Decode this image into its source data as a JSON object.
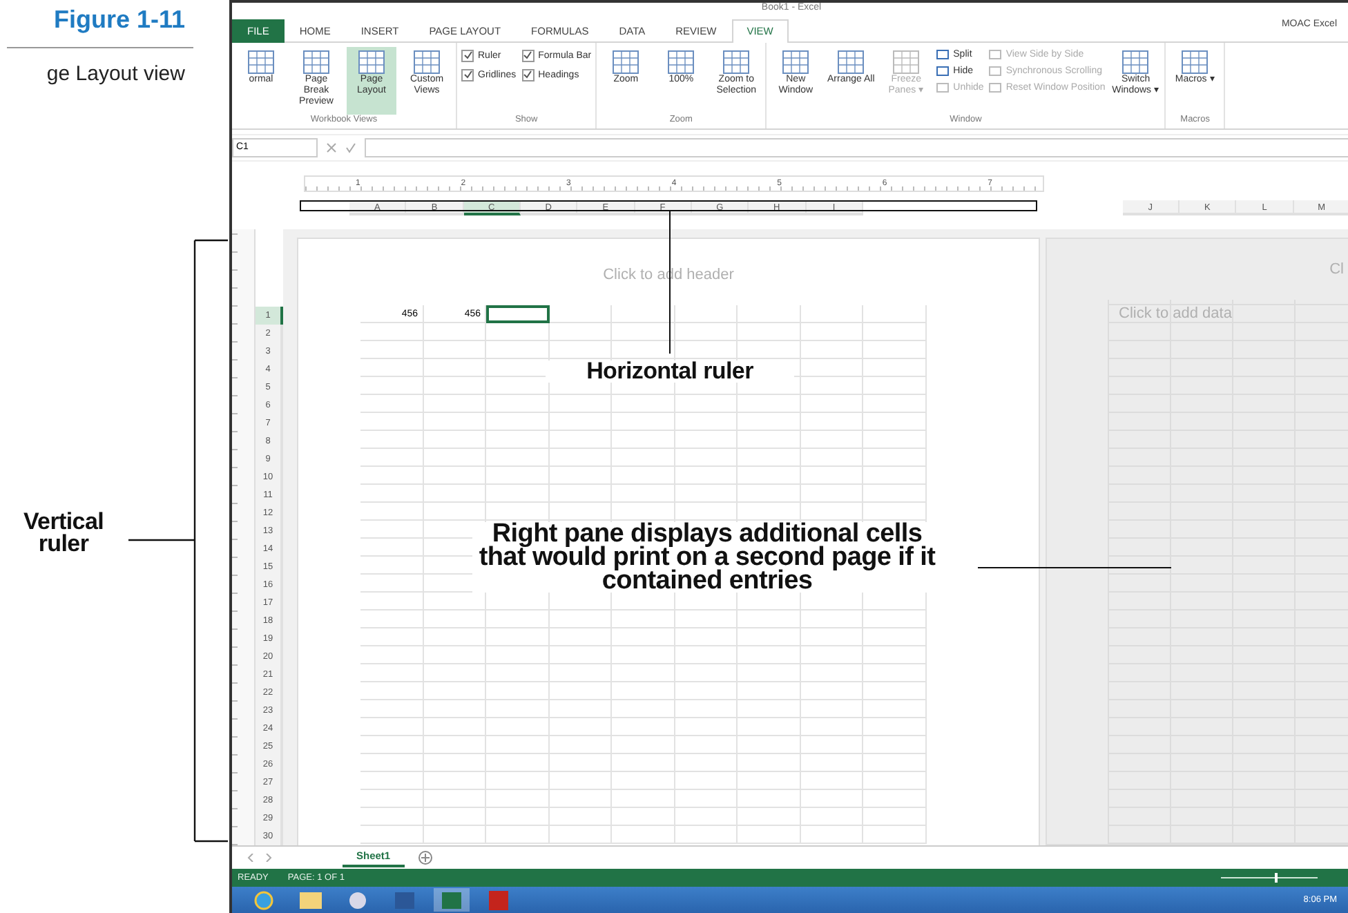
{
  "figure": {
    "number": "Figure 1-11",
    "caption": "ge Layout view"
  },
  "window": {
    "title": "Book1 - Excel",
    "account": "MOAC Excel"
  },
  "tabs": [
    {
      "label": "FILE",
      "selected": false
    },
    {
      "label": "HOME",
      "selected": false
    },
    {
      "label": "INSERT",
      "selected": false
    },
    {
      "label": "PAGE LAYOUT",
      "selected": false
    },
    {
      "label": "FORMULAS",
      "selected": false
    },
    {
      "label": "DATA",
      "selected": false
    },
    {
      "label": "REVIEW",
      "selected": false
    },
    {
      "label": "VIEW",
      "selected": true
    }
  ],
  "ribbon": [
    {
      "label": "Workbook Views",
      "items": [
        {
          "kind": "large",
          "label": "ormal",
          "selected": false
        },
        {
          "kind": "large",
          "label": "Page Break Preview",
          "selected": false
        },
        {
          "kind": "large",
          "label": "Page Layout",
          "selected": true
        },
        {
          "kind": "large",
          "label": "Custom Views",
          "selected": false
        }
      ]
    },
    {
      "label": "Show",
      "items": [
        {
          "kind": "stack",
          "items": [
            {
              "kind": "check",
              "label": "Ruler",
              "checked": true
            },
            {
              "kind": "check",
              "label": "Gridlines",
              "checked": true
            }
          ]
        },
        {
          "kind": "stack",
          "items": [
            {
              "kind": "check",
              "label": "Formula Bar",
              "checked": true
            },
            {
              "kind": "check",
              "label": "Headings",
              "checked": true
            }
          ]
        }
      ]
    },
    {
      "label": "Zoom",
      "items": [
        {
          "kind": "large",
          "label": "Zoom",
          "selected": false
        },
        {
          "kind": "large",
          "label": "100%",
          "selected": false
        },
        {
          "kind": "large",
          "label": "Zoom to Selection",
          "selected": false
        }
      ]
    },
    {
      "label": "Window",
      "items": [
        {
          "kind": "large",
          "label": "New Window",
          "selected": false
        },
        {
          "kind": "large",
          "label": "Arrange All",
          "selected": false
        },
        {
          "kind": "large",
          "label": "Freeze Panes ▾",
          "selected": false,
          "disabled": true
        },
        {
          "kind": "stack",
          "items": [
            {
              "kind": "small",
              "label": "Split",
              "disabled": false
            },
            {
              "kind": "small",
              "label": "Hide",
              "disabled": false
            },
            {
              "kind": "small",
              "label": "Unhide",
              "disabled": true
            }
          ]
        },
        {
          "kind": "stack",
          "items": [
            {
              "kind": "small",
              "label": "View Side by Side",
              "disabled": true
            },
            {
              "kind": "small",
              "label": "Synchronous Scrolling",
              "disabled": true
            },
            {
              "kind": "small",
              "label": "Reset Window Position",
              "disabled": true
            }
          ]
        },
        {
          "kind": "large",
          "label": "Switch Windows ▾",
          "selected": false
        }
      ]
    },
    {
      "label": "Macros",
      "items": [
        {
          "kind": "large",
          "label": "Macros ▾",
          "selected": false
        }
      ]
    }
  ],
  "name_box": "C1",
  "ruler_numbers": [
    "1",
    "2",
    "3",
    "4",
    "5",
    "6",
    "7"
  ],
  "columns": [
    {
      "label": "A",
      "selected": false
    },
    {
      "label": "B",
      "selected": false
    },
    {
      "label": "C",
      "selected": true
    },
    {
      "label": "D",
      "selected": false
    },
    {
      "label": "E",
      "selected": false
    },
    {
      "label": "F",
      "selected": false
    },
    {
      "label": "G",
      "selected": false
    },
    {
      "label": "H",
      "selected": false
    },
    {
      "label": "I",
      "selected": false
    }
  ],
  "columns_right": [
    "J",
    "K",
    "L",
    "M"
  ],
  "page": {
    "header_placeholder": "Click to add header"
  },
  "rows": [
    {
      "label": "1",
      "selected": true,
      "cells": [
        "456",
        "456"
      ]
    },
    {
      "label": "2",
      "selected": false
    },
    {
      "label": "3",
      "selected": false
    },
    {
      "label": "4",
      "selected": false
    },
    {
      "label": "5",
      "selected": false
    },
    {
      "label": "6",
      "selected": false
    },
    {
      "label": "7",
      "selected": false
    },
    {
      "label": "8",
      "selected": false
    },
    {
      "label": "9",
      "selected": false
    },
    {
      "label": "10",
      "selected": false
    },
    {
      "label": "11",
      "selected": false
    },
    {
      "label": "12",
      "selected": false
    },
    {
      "label": "13",
      "selected": false
    },
    {
      "label": "14",
      "selected": false
    },
    {
      "label": "15",
      "selected": false
    },
    {
      "label": "16",
      "selected": false
    },
    {
      "label": "17",
      "selected": false
    },
    {
      "label": "18",
      "selected": false
    },
    {
      "label": "19",
      "selected": false
    },
    {
      "label": "20",
      "selected": false
    },
    {
      "label": "21",
      "selected": false
    },
    {
      "label": "22",
      "selected": false
    },
    {
      "label": "23",
      "selected": false
    },
    {
      "label": "24",
      "selected": false
    },
    {
      "label": "25",
      "selected": false
    },
    {
      "label": "26",
      "selected": false
    },
    {
      "label": "27",
      "selected": false
    },
    {
      "label": "28",
      "selected": false
    },
    {
      "label": "29",
      "selected": false
    },
    {
      "label": "30",
      "selected": false
    }
  ],
  "right_page": {
    "header_partial": "Cl",
    "placeholder": "Click to add data"
  },
  "sheet_tabs": [
    {
      "label": "Sheet1",
      "selected": true
    }
  ],
  "status": {
    "mode": "READY",
    "page": "PAGE: 1 OF 1",
    "zoom": {
      "level": 0.55
    }
  },
  "taskbar": {
    "time": "8:06 PM"
  },
  "callouts": [
    {
      "kind": "vertical",
      "text": "Vertical ruler"
    },
    {
      "kind": "horizontal",
      "text": "Horizontal ruler"
    },
    {
      "kind": "pane",
      "text": "Right pane displays additional cells that would print on a second page if it contained entries"
    }
  ]
}
